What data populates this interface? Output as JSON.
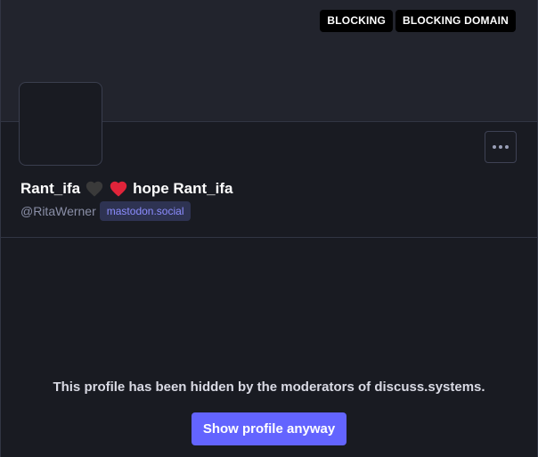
{
  "profile": {
    "relationship_badges": [
      "BLOCKING",
      "BLOCKING DOMAIN"
    ],
    "display_name_part1": "Rant_ifa",
    "display_name_part2": "hope Rant_ifa",
    "emoji_1": "black-heart-icon",
    "emoji_2": "red-heart-icon",
    "handle": "@RitaWerner",
    "server": "mastodon.social",
    "menu_icon": "ellipsis-icon"
  },
  "hidden_notice": {
    "message": "This profile has been hidden by the moderators of discuss.systems.",
    "button_label": "Show profile anyway"
  },
  "colors": {
    "background": "#191b22",
    "banner": "#22242d",
    "accent": "#6364ff",
    "server_tag_bg": "#2e3352",
    "server_tag_text": "#8c8dff",
    "badge_bg": "#000000"
  }
}
